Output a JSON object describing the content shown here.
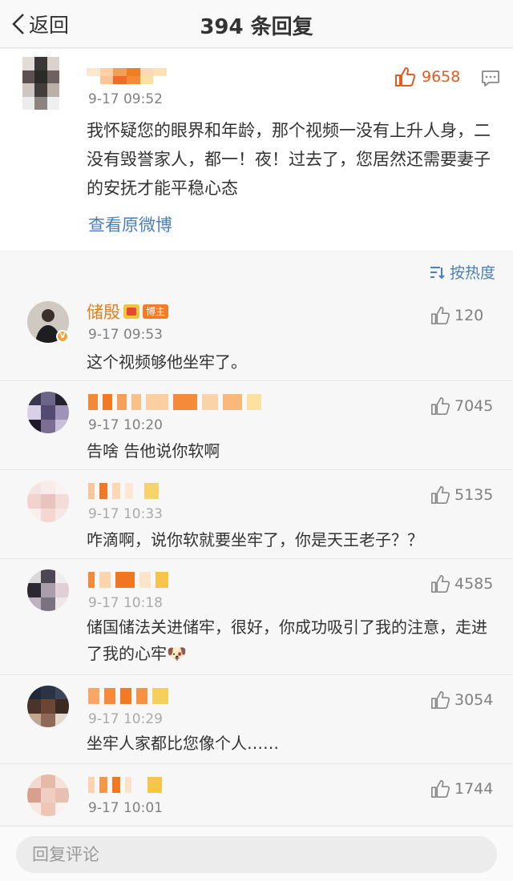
{
  "nav": {
    "back_label": "返回",
    "title": "394 条回复"
  },
  "root_comment": {
    "time": "9-17 09:52",
    "likes": "9658",
    "text": "我怀疑您的眼界和年龄，那个视频一没有上升人身，二没有毁誉家人，都一！夜！过去了，您居然还需要妻子的安抚才能平稳心态",
    "view_original": "查看原微博"
  },
  "sort": {
    "label": "按热度"
  },
  "replies": [
    {
      "name": "储殷",
      "badge": "博主",
      "time": "9-17 09:53",
      "likes": "120",
      "text": "这个视频够他坐牢了。"
    },
    {
      "name": "",
      "time": "9-17 10:20",
      "likes": "7045",
      "text": "告啥 告他说你软啊"
    },
    {
      "name": "",
      "time": "9-17 10:33",
      "likes": "5135",
      "text": "咋滴啊，说你软就要坐牢了，你是天王老子？？"
    },
    {
      "name": "",
      "time": "9-17 10:18",
      "likes": "4585",
      "text": "储国储法关进储牢，很好，你成功吸引了我的注意，走进了我的心牢",
      "emoji": "🐶"
    },
    {
      "name": "",
      "time": "9-17 10:29",
      "likes": "3054",
      "text": "坐牢人家都比您像个人……"
    },
    {
      "name": "",
      "time": "9-17 10:01",
      "likes": "1744",
      "text": ""
    }
  ],
  "reply_bar": {
    "placeholder": "回复评论"
  },
  "colors": {
    "accent_orange": "#e35b1e",
    "link_blue": "#4c7eb8",
    "username_orange": "#e37c1a"
  }
}
